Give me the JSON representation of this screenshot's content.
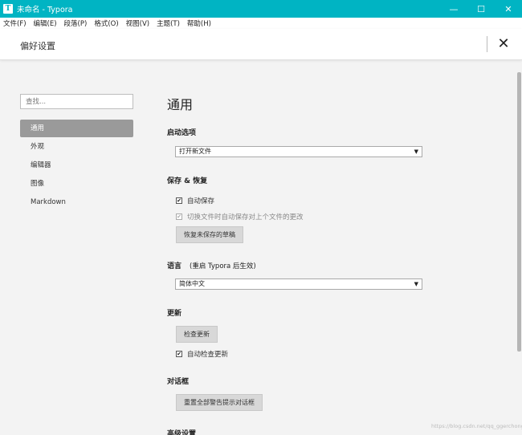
{
  "window": {
    "title": "未命名 - Typora",
    "app_icon_glyph": "T",
    "minimize_glyph": "—",
    "maximize_glyph": "☐",
    "close_glyph": "✕"
  },
  "menubar": [
    "文件(F)",
    "编辑(E)",
    "段落(P)",
    "格式(O)",
    "视图(V)",
    "主题(T)",
    "帮助(H)"
  ],
  "header": {
    "title": "偏好设置",
    "close_glyph": "✕"
  },
  "sidebar": {
    "search_placeholder": "查找...",
    "items": [
      {
        "label": "通用",
        "active": true
      },
      {
        "label": "外观",
        "active": false
      },
      {
        "label": "编辑器",
        "active": false
      },
      {
        "label": "图像",
        "active": false
      },
      {
        "label": "Markdown",
        "active": false
      }
    ]
  },
  "main": {
    "heading": "通用",
    "startup": {
      "title": "启动选项",
      "selected": "打开新文件"
    },
    "save": {
      "title": "保存 & 恢复",
      "autosave": {
        "label": "自动保存",
        "checked": true
      },
      "switch_save": {
        "label": "切换文件时自动保存对上个文件的更改",
        "checked": true,
        "disabled": true
      },
      "restore_button": "恢复未保存的草稿"
    },
    "language": {
      "title": "语言",
      "note": "(重启 Typora 后生效)",
      "selected": "简体中文"
    },
    "update": {
      "title": "更新",
      "check_button": "检查更新",
      "auto_check": {
        "label": "自动检查更新",
        "checked": true
      }
    },
    "dialog": {
      "title": "对话框",
      "reset_button": "重置全部警告提示对话框"
    },
    "advanced": {
      "title": "高级设置"
    }
  },
  "watermark": "https://blog.csdn.net/qq_ggerchong",
  "colors": {
    "titlebar": "#00b4c3",
    "active_nav": "#9a9a9a"
  },
  "icons": {
    "select_arrow": "▼",
    "check": "✔"
  }
}
